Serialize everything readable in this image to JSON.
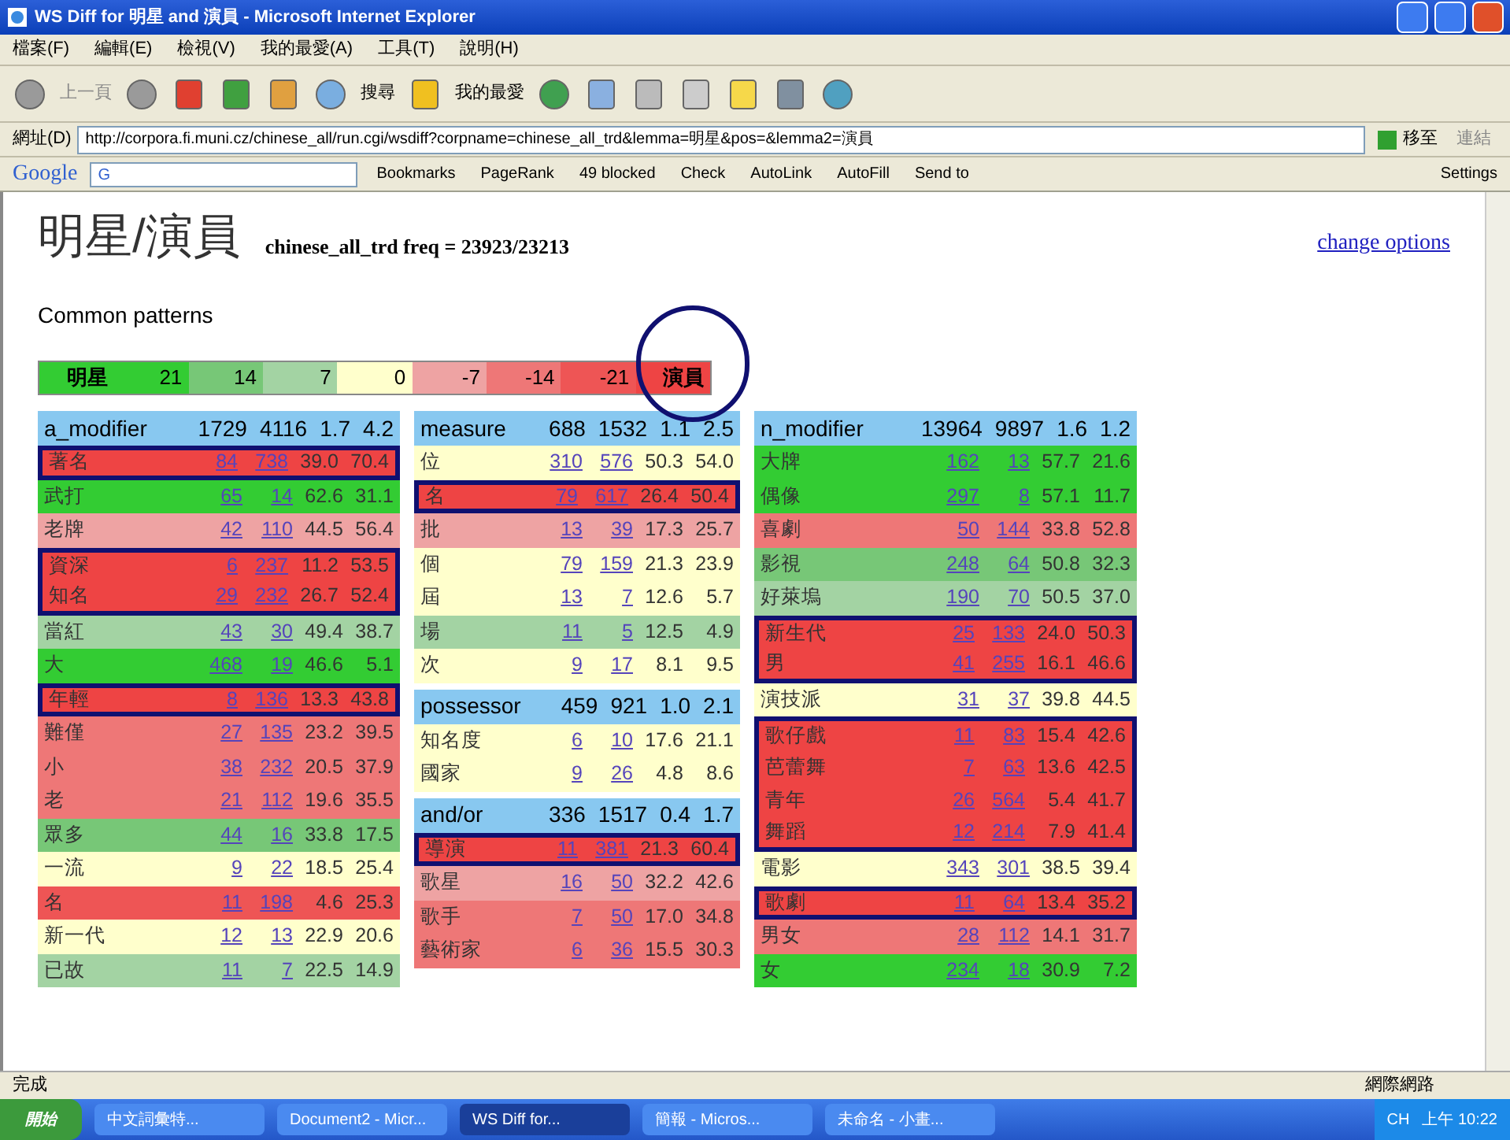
{
  "window": {
    "title": "WS Diff for 明星 and 演員 - Microsoft Internet Explorer"
  },
  "menu": [
    "檔案(F)",
    "編輯(E)",
    "檢視(V)",
    "我的最愛(A)",
    "工具(T)",
    "說明(H)"
  ],
  "toolbar": {
    "back": "上一頁",
    "search": "搜尋",
    "favorites": "我的最愛"
  },
  "address": {
    "label": "網址(D)",
    "value": "http://corpora.fi.muni.cz/chinese_all/run.cgi/wsdiff?corpname=chinese_all_trd&lemma=明星&pos=&lemma2=演員",
    "go": "移至",
    "links": "連結"
  },
  "google_bar": {
    "logo": "Google",
    "search_value": "G",
    "items": [
      "Bookmarks",
      "PageRank",
      "49 blocked",
      "Check",
      "AutoLink",
      "AutoFill",
      "Send to"
    ],
    "settings": "Settings"
  },
  "page": {
    "heading": "明星/演員",
    "subheading": "chinese_all_trd freq = 23923/23213",
    "change_options": "change options",
    "section": "Common patterns",
    "legend": [
      {
        "label": "明星",
        "color": "#33cc33",
        "bold": true,
        "circled": false
      },
      {
        "label": "21",
        "color": "#33cc33",
        "bold": false,
        "circled": false
      },
      {
        "label": "14",
        "color": "#77c777",
        "bold": false,
        "circled": false
      },
      {
        "label": "7",
        "color": "#a3d3a3",
        "bold": false,
        "circled": false
      },
      {
        "label": "0",
        "color": "#ffffcc",
        "bold": false,
        "circled": false
      },
      {
        "label": "-7",
        "color": "#eea3a3",
        "bold": false,
        "circled": false
      },
      {
        "label": "-14",
        "color": "#ee7777",
        "bold": false,
        "circled": false
      },
      {
        "label": "-21",
        "color": "#ee5555",
        "bold": false,
        "circled": false
      },
      {
        "label": "演員",
        "color": "#ee4444",
        "bold": true,
        "circled": true
      }
    ],
    "columns": [
      [
        {
          "header": [
            "a_modifier",
            "1729",
            "4116",
            "1.7",
            "4.2"
          ],
          "rows": [
            {
              "word": "著名",
              "values": [
                "84",
                "738",
                "39.0",
                "70.4"
              ],
              "color": "#ee4444",
              "boxed": true
            },
            {
              "word": "武打",
              "values": [
                "65",
                "14",
                "62.6",
                "31.1"
              ],
              "color": "#33cc33",
              "boxed": false
            },
            {
              "word": "老牌",
              "values": [
                "42",
                "110",
                "44.5",
                "56.4"
              ],
              "color": "#eea3a3",
              "boxed": false
            },
            {
              "word": "資深",
              "values": [
                "6",
                "237",
                "11.2",
                "53.5"
              ],
              "color": "#ee4444",
              "boxed": true
            },
            {
              "word": "知名",
              "values": [
                "29",
                "232",
                "26.7",
                "52.4"
              ],
              "color": "#ee4444",
              "boxed": true
            },
            {
              "word": "當紅",
              "values": [
                "43",
                "30",
                "49.4",
                "38.7"
              ],
              "color": "#a3d3a3",
              "boxed": false
            },
            {
              "word": "大",
              "values": [
                "468",
                "19",
                "46.6",
                "5.1"
              ],
              "color": "#33cc33",
              "boxed": false
            },
            {
              "word": "年輕",
              "values": [
                "8",
                "136",
                "13.3",
                "43.8"
              ],
              "color": "#ee4444",
              "boxed": true
            },
            {
              "word": "難僅",
              "values": [
                "27",
                "135",
                "23.2",
                "39.5"
              ],
              "color": "#ee7777",
              "boxed": false
            },
            {
              "word": "小",
              "values": [
                "38",
                "232",
                "20.5",
                "37.9"
              ],
              "color": "#ee7777",
              "boxed": false
            },
            {
              "word": "老",
              "values": [
                "21",
                "112",
                "19.6",
                "35.5"
              ],
              "color": "#ee7777",
              "boxed": false
            },
            {
              "word": "眾多",
              "values": [
                "44",
                "16",
                "33.8",
                "17.5"
              ],
              "color": "#77c777",
              "boxed": false
            },
            {
              "word": "一流",
              "values": [
                "9",
                "22",
                "18.5",
                "25.4"
              ],
              "color": "#ffffcc",
              "boxed": false
            },
            {
              "word": "名",
              "values": [
                "11",
                "198",
                "4.6",
                "25.3"
              ],
              "color": "#ee5555",
              "boxed": false
            },
            {
              "word": "新一代",
              "values": [
                "12",
                "13",
                "22.9",
                "20.6"
              ],
              "color": "#ffffcc",
              "boxed": false
            },
            {
              "word": "已故",
              "values": [
                "11",
                "7",
                "22.5",
                "14.9"
              ],
              "color": "#a3d3a3",
              "boxed": false
            }
          ]
        }
      ],
      [
        {
          "header": [
            "measure",
            "688",
            "1532",
            "1.1",
            "2.5"
          ],
          "rows": [
            {
              "word": "位",
              "values": [
                "310",
                "576",
                "50.3",
                "54.0"
              ],
              "color": "#ffffcc",
              "boxed": false
            },
            {
              "word": "名",
              "values": [
                "79",
                "617",
                "26.4",
                "50.4"
              ],
              "color": "#ee4444",
              "boxed": true
            },
            {
              "word": "批",
              "values": [
                "13",
                "39",
                "17.3",
                "25.7"
              ],
              "color": "#eea3a3",
              "boxed": false
            },
            {
              "word": "個",
              "values": [
                "79",
                "159",
                "21.3",
                "23.9"
              ],
              "color": "#ffffcc",
              "boxed": false
            },
            {
              "word": "屆",
              "values": [
                "13",
                "7",
                "12.6",
                "5.7"
              ],
              "color": "#ffffcc",
              "boxed": false
            },
            {
              "word": "場",
              "values": [
                "11",
                "5",
                "12.5",
                "4.9"
              ],
              "color": "#a3d3a3",
              "boxed": false
            },
            {
              "word": "次",
              "values": [
                "9",
                "17",
                "8.1",
                "9.5"
              ],
              "color": "#ffffcc",
              "boxed": false
            }
          ]
        },
        {
          "header": [
            "possessor",
            "459",
            "921",
            "1.0",
            "2.1"
          ],
          "rows": [
            {
              "word": "知名度",
              "values": [
                "6",
                "10",
                "17.6",
                "21.1"
              ],
              "color": "#ffffcc",
              "boxed": false
            },
            {
              "word": "國家",
              "values": [
                "9",
                "26",
                "4.8",
                "8.6"
              ],
              "color": "#ffffcc",
              "boxed": false
            }
          ]
        },
        {
          "header": [
            "and/or",
            "336",
            "1517",
            "0.4",
            "1.7"
          ],
          "rows": [
            {
              "word": "導演",
              "values": [
                "11",
                "381",
                "21.3",
                "60.4"
              ],
              "color": "#ee4444",
              "boxed": true
            },
            {
              "word": "歌星",
              "values": [
                "16",
                "50",
                "32.2",
                "42.6"
              ],
              "color": "#eea3a3",
              "boxed": false
            },
            {
              "word": "歌手",
              "values": [
                "7",
                "50",
                "17.0",
                "34.8"
              ],
              "color": "#ee7777",
              "boxed": false
            },
            {
              "word": "藝術家",
              "values": [
                "6",
                "36",
                "15.5",
                "30.3"
              ],
              "color": "#ee7777",
              "boxed": false
            }
          ]
        }
      ],
      [
        {
          "header": [
            "n_modifier",
            "13964",
            "9897",
            "1.6",
            "1.2"
          ],
          "rows": [
            {
              "word": "大牌",
              "values": [
                "162",
                "13",
                "57.7",
                "21.6"
              ],
              "color": "#33cc33",
              "boxed": false
            },
            {
              "word": "偶像",
              "values": [
                "297",
                "8",
                "57.1",
                "11.7"
              ],
              "color": "#33cc33",
              "boxed": false
            },
            {
              "word": "喜劇",
              "values": [
                "50",
                "144",
                "33.8",
                "52.8"
              ],
              "color": "#ee7777",
              "boxed": false
            },
            {
              "word": "影視",
              "values": [
                "248",
                "64",
                "50.8",
                "32.3"
              ],
              "color": "#77c777",
              "boxed": false
            },
            {
              "word": "好萊塢",
              "values": [
                "190",
                "70",
                "50.5",
                "37.0"
              ],
              "color": "#a3d3a3",
              "boxed": false
            },
            {
              "word": "新生代",
              "values": [
                "25",
                "133",
                "24.0",
                "50.3"
              ],
              "color": "#ee4444",
              "boxed": true
            },
            {
              "word": "男",
              "values": [
                "41",
                "255",
                "16.1",
                "46.6"
              ],
              "color": "#ee4444",
              "boxed": true
            },
            {
              "word": "演技派",
              "values": [
                "31",
                "37",
                "39.8",
                "44.5"
              ],
              "color": "#ffffcc",
              "boxed": false
            },
            {
              "word": "歌仔戲",
              "values": [
                "11",
                "83",
                "15.4",
                "42.6"
              ],
              "color": "#ee4444",
              "boxed": true
            },
            {
              "word": "芭蕾舞",
              "values": [
                "7",
                "63",
                "13.6",
                "42.5"
              ],
              "color": "#ee4444",
              "boxed": true
            },
            {
              "word": "青年",
              "values": [
                "26",
                "564",
                "5.4",
                "41.7"
              ],
              "color": "#ee4444",
              "boxed": true
            },
            {
              "word": "舞蹈",
              "values": [
                "12",
                "214",
                "7.9",
                "41.4"
              ],
              "color": "#ee4444",
              "boxed": true
            },
            {
              "word": "電影",
              "values": [
                "343",
                "301",
                "38.5",
                "39.4"
              ],
              "color": "#ffffcc",
              "boxed": false
            },
            {
              "word": "歌劇",
              "values": [
                "11",
                "64",
                "13.4",
                "35.2"
              ],
              "color": "#ee4444",
              "boxed": true
            },
            {
              "word": "男女",
              "values": [
                "28",
                "112",
                "14.1",
                "31.7"
              ],
              "color": "#ee7777",
              "boxed": false
            },
            {
              "word": "女",
              "values": [
                "234",
                "18",
                "30.9",
                "7.2"
              ],
              "color": "#33cc33",
              "boxed": false
            }
          ]
        }
      ]
    ]
  },
  "status_bar": {
    "text": "完成",
    "zone": "網際網路"
  },
  "taskbar": {
    "start": "開始",
    "tasks": [
      {
        "label": "中文詞彙特...",
        "selected": false
      },
      {
        "label": "Document2 - Micr...",
        "selected": false
      },
      {
        "label": "WS Diff for...",
        "selected": true
      },
      {
        "label": "簡報 - Micros...",
        "selected": false
      },
      {
        "label": "未命名 - 小畫...",
        "selected": false
      }
    ],
    "lang": "CH",
    "clock": "上午 10:22"
  }
}
